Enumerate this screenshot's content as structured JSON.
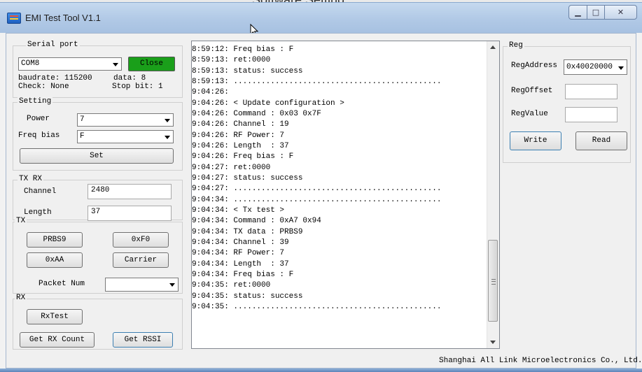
{
  "overlay_text": "Software Setting",
  "window": {
    "title": "EMI Test Tool V1.1"
  },
  "serial": {
    "group_label": "Serial port",
    "port": "COM8",
    "close_label": "Close",
    "close_color": "#1a9f1a",
    "baudrate": "baudrate: 115200",
    "data": "data: 8",
    "check": "Check: None",
    "stopbit": "Stop bit: 1"
  },
  "setting": {
    "group_label": "Setting",
    "power_label": "Power",
    "power_value": "7",
    "freqbias_label": "Freq bias",
    "freqbias_value": "F",
    "set_label": "Set"
  },
  "txrx": {
    "group_label": "TX  RX",
    "channel_label": "Channel",
    "channel_value": "2480",
    "length_label": "Length",
    "length_value": "37"
  },
  "tx": {
    "group_label": "TX",
    "prbs9_label": "PRBS9",
    "oxf0_label": "0xF0",
    "oxaa_label": "0xAA",
    "carrier_label": "Carrier",
    "packet_num_label": "Packet Num",
    "packet_num_value": ""
  },
  "rx": {
    "group_label": "RX",
    "rxtest_label": "RxTest",
    "get_rx_count_label": "Get RX Count",
    "get_rssi_label": "Get RSSI"
  },
  "log": {
    "lines": [
      "8:59:12: Freq bias : F",
      "8:59:13: ret:0000",
      "8:59:13: status: success",
      "8:59:13: .............................................",
      "9:04:26:",
      "9:04:26: < Update configuration >",
      "9:04:26: Command : 0x03 0x7F",
      "9:04:26: Channel : 19",
      "9:04:26: RF Power: 7",
      "9:04:26: Length  : 37",
      "9:04:26: Freq bias : F",
      "9:04:27: ret:0000",
      "9:04:27: status: success",
      "9:04:27: .............................................",
      "9:04:34: .............................................",
      "9:04:34: < Tx test >",
      "9:04:34: Command : 0xA7 0x94",
      "9:04:34: TX data : PRBS9",
      "9:04:34: Channel : 39",
      "9:04:34: RF Power: 7",
      "9:04:34: Length  : 37",
      "9:04:34: Freq bias : F",
      "9:04:35: ret:0000",
      "9:04:35: status: success",
      "9:04:35: ............................................."
    ],
    "scroll_thumb_start": 0.66,
    "scroll_thumb_end": 0.95
  },
  "reg": {
    "group_label": "Reg",
    "regaddress_label": "RegAddress",
    "regaddress_value": "0x40020000",
    "regoffset_label": "RegOffset",
    "regoffset_value": "",
    "regvalue_label": "RegValue",
    "regvalue_value": "",
    "write_label": "Write",
    "read_label": "Read"
  },
  "footer": "Shanghai All Link Microelectronics Co., Ltd.",
  "window_buttons": {
    "minimize": "▁",
    "maximize": "□",
    "close": "✕"
  }
}
